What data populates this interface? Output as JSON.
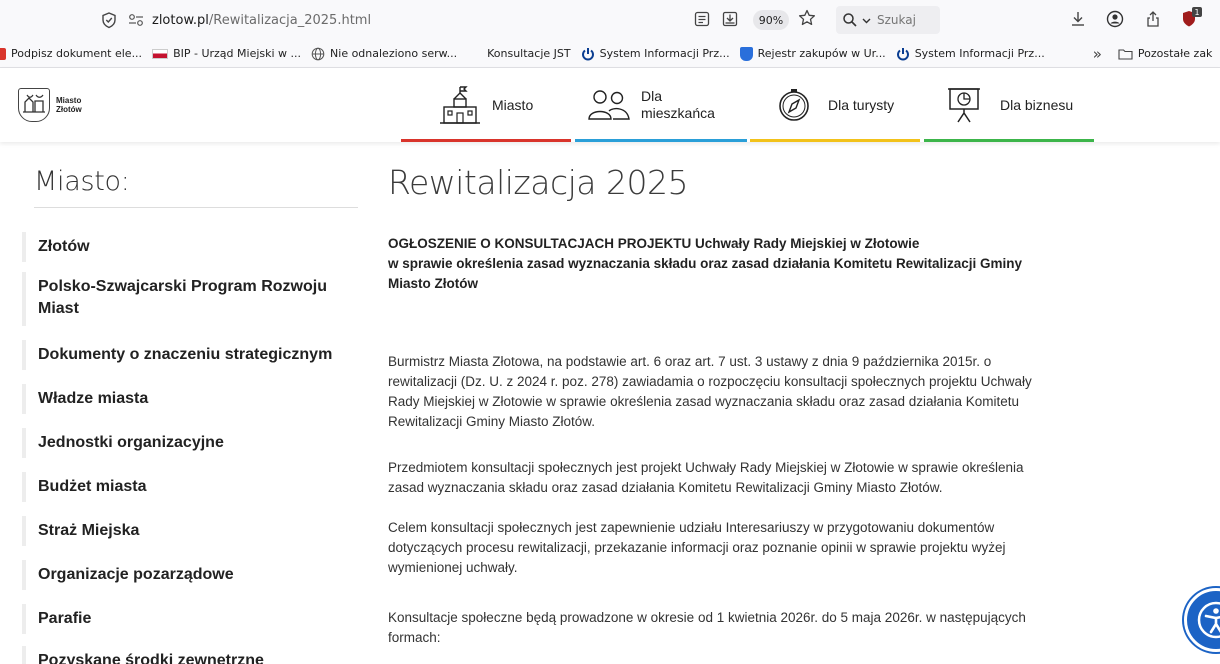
{
  "browser": {
    "url_host": "zlotow.pl",
    "url_path": "/Rewitalizacja_2025.html",
    "zoom": "90%",
    "search_placeholder": "Szukaj",
    "ext_badge": "1"
  },
  "bookmarks": [
    {
      "label": "Podpisz dokument ele...",
      "color": "#d9342b"
    },
    {
      "label": "BIP - Urząd Miejski w ...",
      "color": "#c4122f"
    },
    {
      "label": "Nie odnaleziono serw...",
      "color": "#555555"
    },
    {
      "label": "Konsultacje JST",
      "color": "#ffffff"
    },
    {
      "label": "System Informacji Prz...",
      "color": "#0a3d91"
    },
    {
      "label": "Rejestr zakupów w Ur...",
      "color": "#2a6fdb"
    },
    {
      "label": "System Informacji Prz...",
      "color": "#0a3d91"
    }
  ],
  "bookmarks_more": "»",
  "bookmarks_folder": "Pozostałe zak",
  "site": {
    "logo_line1": "Miasto",
    "logo_line2": "Złotów",
    "nav": [
      {
        "label": "Miasto",
        "color": "#d9342b"
      },
      {
        "label_line1": "Dla",
        "label_line2": "mieszkańca",
        "color": "#2a9fd8"
      },
      {
        "label": "Dla turysty",
        "color": "#f2c21a"
      },
      {
        "label": "Dla biznesu",
        "color": "#3cb54a"
      }
    ]
  },
  "sidebar": {
    "title": "Miasto:",
    "items": [
      "Złotów",
      "Polsko-Szwajcarski Program Rozwoju Miast",
      "Dokumenty o znaczeniu strategicznym",
      "Władze miasta",
      "Jednostki organizacyjne",
      "Budżet miasta",
      "Straż Miejska",
      "Organizacje pozarządowe",
      "Parafie",
      "Pozyskane środki zewnętrzne"
    ]
  },
  "main": {
    "title": "Rewitalizacja 2025",
    "heading": "OGŁOSZENIE O KONSULTACJACH PROJEKTU Uchwały Rady Miejskiej w Złotowie w sprawie określenia zasad wyznaczania składu oraz zasad działania Komitetu Rewitalizacji Gminy Miasto Złotów",
    "heading_l1": "OGŁOSZENIE O KONSULTACJACH PROJEKTU Uchwały Rady Miejskiej w Złotowie",
    "heading_l2": "w sprawie określenia zasad wyznaczania składu oraz zasad działania Komitetu Rewitalizacji Gminy",
    "heading_l3": "Miasto Złotów",
    "p1_l1": "Burmistrz Miasta Złotowa, na podstawie art. 6 oraz art. 7 ust. 3 ustawy z dnia 9 października 2015r. o",
    "p1_l2": "rewitalizacji (Dz. U. z 2024 r. poz. 278) zawiadamia o rozpoczęciu konsultacji społecznych projektu Uchwały",
    "p1_l3": "Rady Miejskiej w Złotowie w sprawie określenia zasad wyznaczania składu oraz zasad działania Komitetu",
    "p1_l4": "Rewitalizacji Gminy Miasto Złotów.",
    "p2_l1": "Przedmiotem konsultacji społecznych jest projekt Uchwały Rady Miejskiej w Złotowie w sprawie określenia",
    "p2_l2": "zasad wyznaczania składu oraz zasad działania Komitetu Rewitalizacji Gminy Miasto Złotów.",
    "p3_l1": "Celem konsultacji społecznych jest zapewnienie udziału Interesariuszy w przygotowaniu dokumentów",
    "p3_l2": "dotyczących procesu rewitalizacji, przekazanie informacji oraz poznanie opinii w sprawie projektu wyżej",
    "p3_l3": "wymienionej uchwały.",
    "p4_l1": "Konsultacje społeczne będą prowadzone w okresie od 1 kwietnia 2026r. do 5 maja 2026r. w następujących",
    "p4_l2": "formach:"
  }
}
